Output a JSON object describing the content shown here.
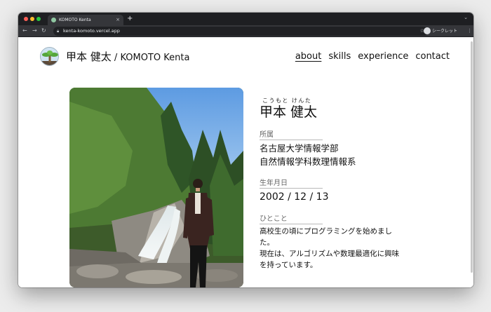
{
  "browser": {
    "tab_title": "KOMOTO Kenta",
    "tab_close": "×",
    "new_tab": "+",
    "url": "kenta-komoto.vercel.app",
    "incognito_label": "シークレット"
  },
  "site": {
    "title_ja": "甲本 健太",
    "title_sep": " / ",
    "title_en": "KOMOTO Kenta",
    "nav": [
      "about",
      "skills",
      "experience",
      "contact"
    ],
    "active_nav": "about"
  },
  "profile": {
    "ruby": "こうもと けんた",
    "name": "甲本 健太",
    "affiliation_label": "所属",
    "affiliation_line1": "名古屋大学情報学部",
    "affiliation_line2": "自然情報学科数理情報系",
    "birthday_label": "生年月日",
    "birthday": "2002 / 12 / 13",
    "comment_label": "ひとこと",
    "comment_line1": "高校生の頃にプログラミングを始めました。",
    "comment_line2": "現在は、アルゴリズムや数理最適化に興味を持っています。"
  },
  "colors": {
    "accent_text": "#111111",
    "label_gray": "#666666",
    "browser_dark": "#35363a"
  },
  "icons": {
    "back": "back-arrow-icon",
    "forward": "forward-arrow-icon",
    "reload": "reload-icon",
    "lock": "lock-icon",
    "star": "bookmark-star-icon",
    "extensions": "puzzle-icon",
    "sidepanel": "side-panel-icon",
    "menu": "kebab-menu-icon"
  }
}
